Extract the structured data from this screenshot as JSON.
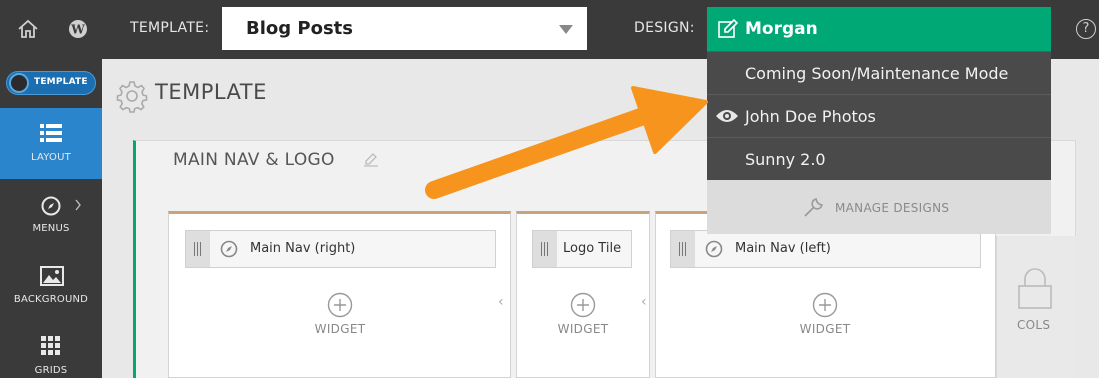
{
  "topbar": {
    "template_label": "TEMPLATE:",
    "template_value": "Blog Posts",
    "design_label": "DESIGN:",
    "help_glyph": "?"
  },
  "design_dropdown": {
    "selected": "Morgan",
    "options": [
      {
        "label": "Coming Soon/Maintenance Mode",
        "icon": ""
      },
      {
        "label": "John Doe Photos",
        "icon": "eye-icon"
      },
      {
        "label": "Sunny 2.0",
        "icon": ""
      }
    ],
    "manage_label": "MANAGE DESIGNS"
  },
  "sidebar": {
    "toggle_label": "TEMPLATE",
    "items": [
      {
        "label": "LAYOUT",
        "icon": "list-icon",
        "active": true
      },
      {
        "label": "MENUS",
        "icon": "compass-icon",
        "active": false
      },
      {
        "label": "BACKGROUND",
        "icon": "image-icon",
        "active": false
      },
      {
        "label": "GRIDS",
        "icon": "grid-icon",
        "active": false
      }
    ]
  },
  "main": {
    "title": "TEMPLATE",
    "section_title": "MAIN NAV & LOGO",
    "columns": [
      {
        "tile": "Main Nav (right)",
        "widget_label": "WIDGET"
      },
      {
        "tile": "Logo Tile",
        "widget_label": "WIDGET"
      },
      {
        "tile": "Main Nav (left)",
        "widget_label": "WIDGET"
      }
    ],
    "cols_label": "COLS"
  },
  "colors": {
    "topbar_bg": "#3a3a3a",
    "accent_green": "#00a875",
    "active_blue": "#2a85cc",
    "arrow_orange": "#f7941d",
    "column_border": "#c9a27e"
  }
}
